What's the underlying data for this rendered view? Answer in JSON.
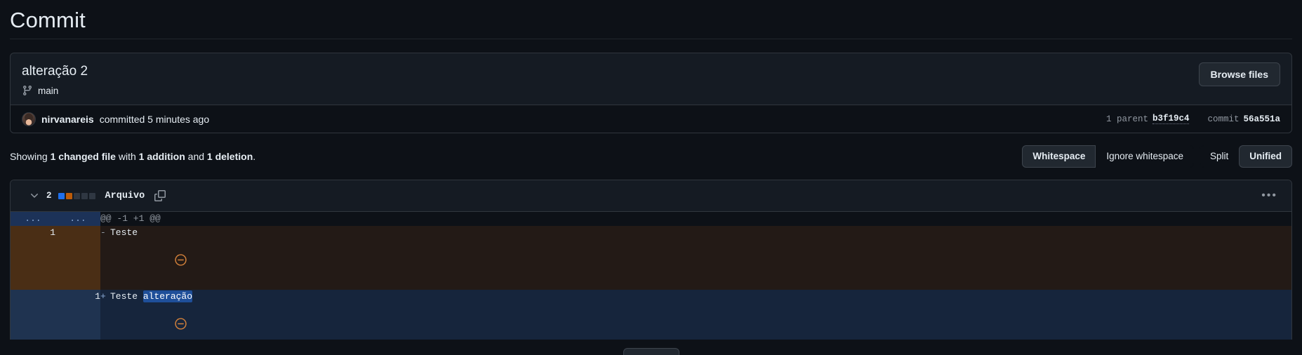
{
  "page": {
    "heading": "Commit"
  },
  "commit": {
    "title": "alteração 2",
    "branch_icon": "git-branch-icon",
    "branch": "main",
    "browse_files_label": "Browse files",
    "author": "nirvanareis",
    "committed_text": "committed 5 minutes ago",
    "parent_label": "1 parent",
    "parent_hash": "b3f19c4",
    "commit_label": "commit",
    "commit_hash": "56a551a"
  },
  "summary": {
    "prefix": "Showing ",
    "changed_files": "1 changed file",
    "mid": " with ",
    "additions": "1 addition",
    "conj": " and ",
    "deletions": "1 deletion",
    "suffix": "."
  },
  "toolbar": {
    "whitespace_label": "Whitespace",
    "ignore_whitespace_label": "Ignore whitespace",
    "split_label": "Split",
    "unified_label": "Unified"
  },
  "file": {
    "changes_count": "2",
    "name": "Arquivo",
    "chevron_icon": "chevron-down-icon",
    "copy_icon": "copy-icon",
    "kebab_icon": "kebab-horizontal-icon",
    "diffstat": [
      "#1f6feb",
      "#bd5b08",
      "#2f3742",
      "#2f3742",
      "#2f3742"
    ]
  },
  "diff": {
    "hunk": {
      "old_dots": "...",
      "new_dots": "...",
      "header": "@@ -1 +1 @@"
    },
    "deletion": {
      "old_line": "1",
      "new_line": "",
      "sign": "-",
      "text": "Teste",
      "marker_icon": "circle-minus-icon"
    },
    "addition": {
      "old_line": "",
      "new_line": "1",
      "sign": "+",
      "text_plain": "Teste ",
      "text_highlight": "alteração",
      "marker_icon": "circle-minus-icon"
    }
  },
  "colors": {
    "background": "#0d1117",
    "border": "#30363d",
    "addition_bg": "#16253c",
    "deletion_bg": "#231a16",
    "addition_gutter": "#1f3350",
    "deletion_gutter": "#4a2e15",
    "word_highlight": "#1f4f99",
    "marker_orange": "#d2803a"
  }
}
